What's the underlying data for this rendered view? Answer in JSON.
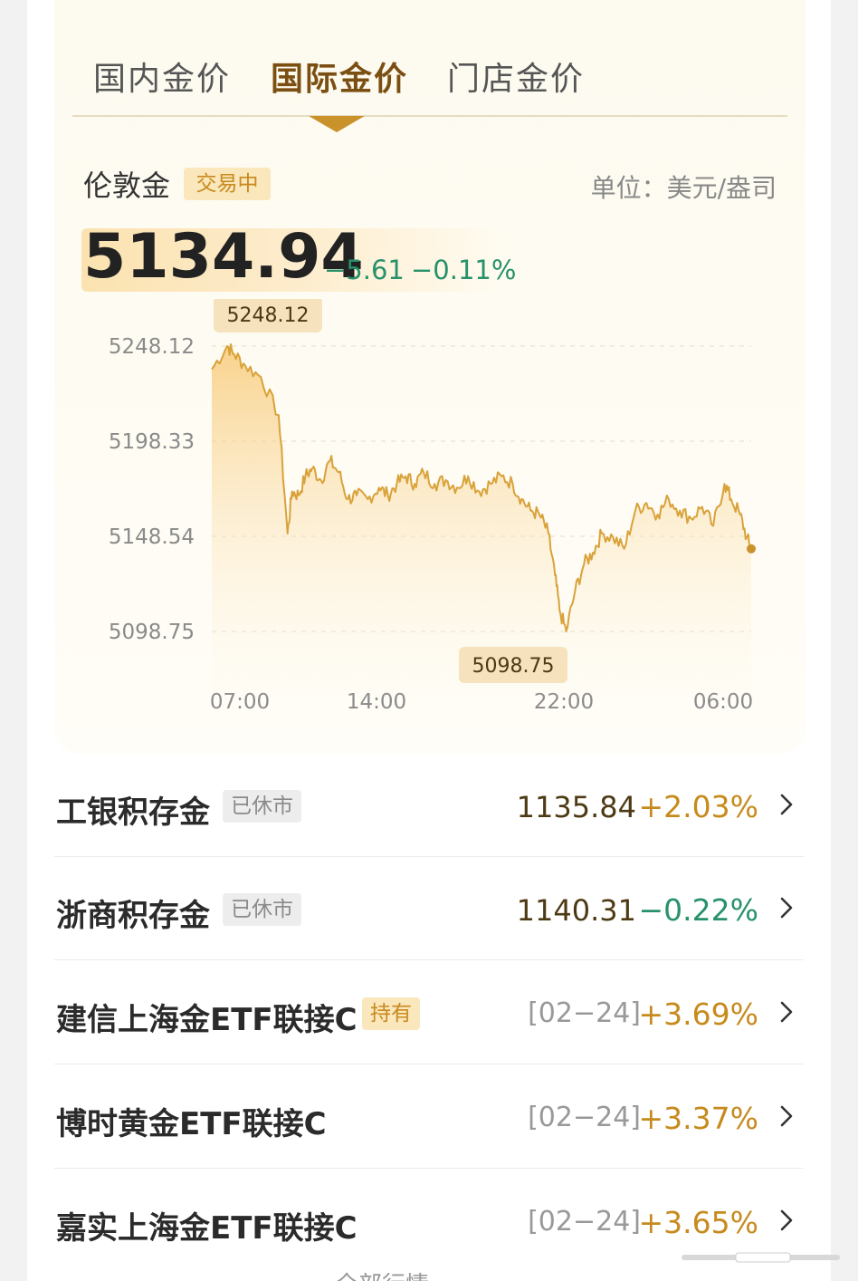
{
  "tabs": [
    {
      "label": "国内金价",
      "active": false
    },
    {
      "label": "国际金价",
      "active": true
    },
    {
      "label": "门店金价",
      "active": false
    }
  ],
  "instrument": {
    "name": "伦敦金",
    "status": "交易中",
    "unit": "单位：美元/盎司",
    "price": "5134.94",
    "change": "−5.61",
    "change_pct": "−0.11%"
  },
  "chart_data": {
    "type": "area",
    "y_ticks": [
      "5248.12",
      "5198.33",
      "5148.54",
      "5098.75"
    ],
    "x_ticks": [
      "07:00",
      "14:00",
      "22:00",
      "06:00"
    ],
    "ylim": [
      5098.75,
      5248.12
    ],
    "x_hours": [
      6.5,
      7.2,
      7.5,
      8.0,
      8.7,
      9.5,
      9.9,
      10.1,
      10.4,
      10.7,
      11.0,
      11.4,
      11.8,
      12.2,
      12.6,
      13.0,
      13.5,
      14.0,
      14.4,
      14.8,
      15.2,
      15.6,
      16.0,
      16.5,
      17.0,
      17.5,
      18.0,
      18.5,
      19.0,
      19.5,
      20.0,
      20.4,
      20.8,
      21.2,
      21.6,
      21.9,
      22.1,
      22.4,
      22.8,
      23.2,
      23.6,
      24.0,
      24.5,
      25.0,
      25.5,
      26.0,
      26.5,
      27.0,
      27.5,
      28.0,
      28.5,
      29.0,
      29.5,
      29.8,
      30.2,
      30.5,
      30.7
    ],
    "values": [
      5236,
      5248.12,
      5244,
      5238,
      5232,
      5212,
      5150,
      5172,
      5170,
      5180,
      5184,
      5178,
      5188,
      5182,
      5168,
      5170,
      5168,
      5174,
      5170,
      5176,
      5180,
      5176,
      5182,
      5176,
      5178,
      5174,
      5180,
      5172,
      5176,
      5180,
      5176,
      5168,
      5162,
      5160,
      5150,
      5128,
      5110,
      5098.75,
      5120,
      5134,
      5140,
      5150,
      5148,
      5142,
      5162,
      5166,
      5160,
      5168,
      5162,
      5158,
      5164,
      5154,
      5176,
      5168,
      5160,
      5148,
      5142
    ],
    "max_label": "5248.12",
    "min_label": "5098.75"
  },
  "products": [
    {
      "name": "工银积存金",
      "tag": "已休市",
      "tag_type": "closed",
      "value": "1135.84",
      "date": "",
      "pct": "+2.03%",
      "direction": "up"
    },
    {
      "name": "浙商积存金",
      "tag": "已休市",
      "tag_type": "closed",
      "value": "1140.31",
      "date": "",
      "pct": "−0.22%",
      "direction": "down"
    },
    {
      "name": "建信上海金ETF联接C",
      "tag": "持有",
      "tag_type": "hold",
      "value": "",
      "date": "[02−24]",
      "pct": "+3.69%",
      "direction": "up"
    },
    {
      "name": "博时黄金ETF联接C",
      "tag": "",
      "tag_type": "",
      "value": "",
      "date": "[02−24]",
      "pct": "+3.37%",
      "direction": "up"
    },
    {
      "name": "嘉实上海金ETF联接C",
      "tag": "",
      "tag_type": "",
      "value": "",
      "date": "[02−24]",
      "pct": "+3.65%",
      "direction": "up"
    }
  ],
  "more_link": "全部行情 ›",
  "colors": {
    "gold": "#c9922b",
    "line": "#d9a23a",
    "up": "#c78a1d",
    "down": "#27916a"
  }
}
